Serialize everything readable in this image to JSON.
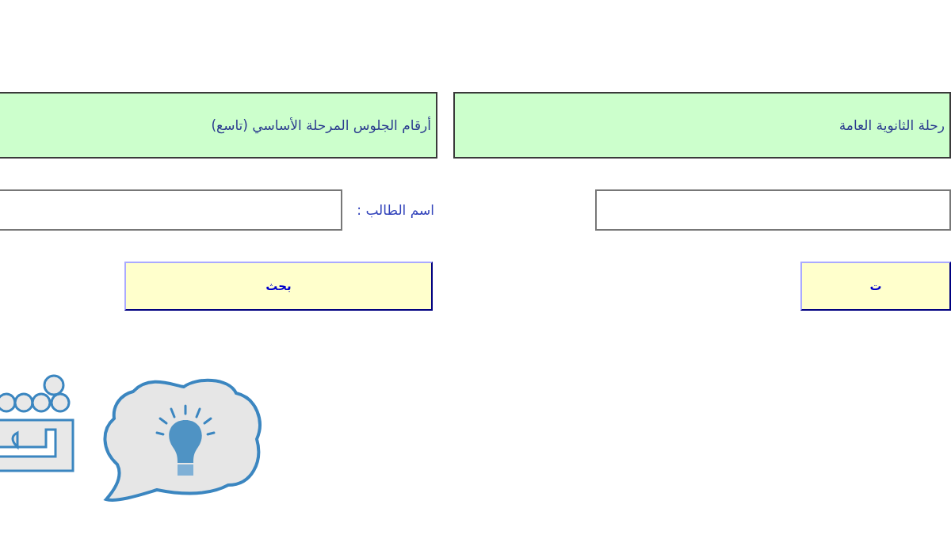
{
  "panels": [
    {
      "heading": "رحلة الثانوية العامة",
      "button": "ت"
    },
    {
      "heading": "أرقام الجلوس المرحلة الأساسي (تاسع)",
      "field_label": "اسم الطالب :",
      "button": "بحث"
    }
  ]
}
